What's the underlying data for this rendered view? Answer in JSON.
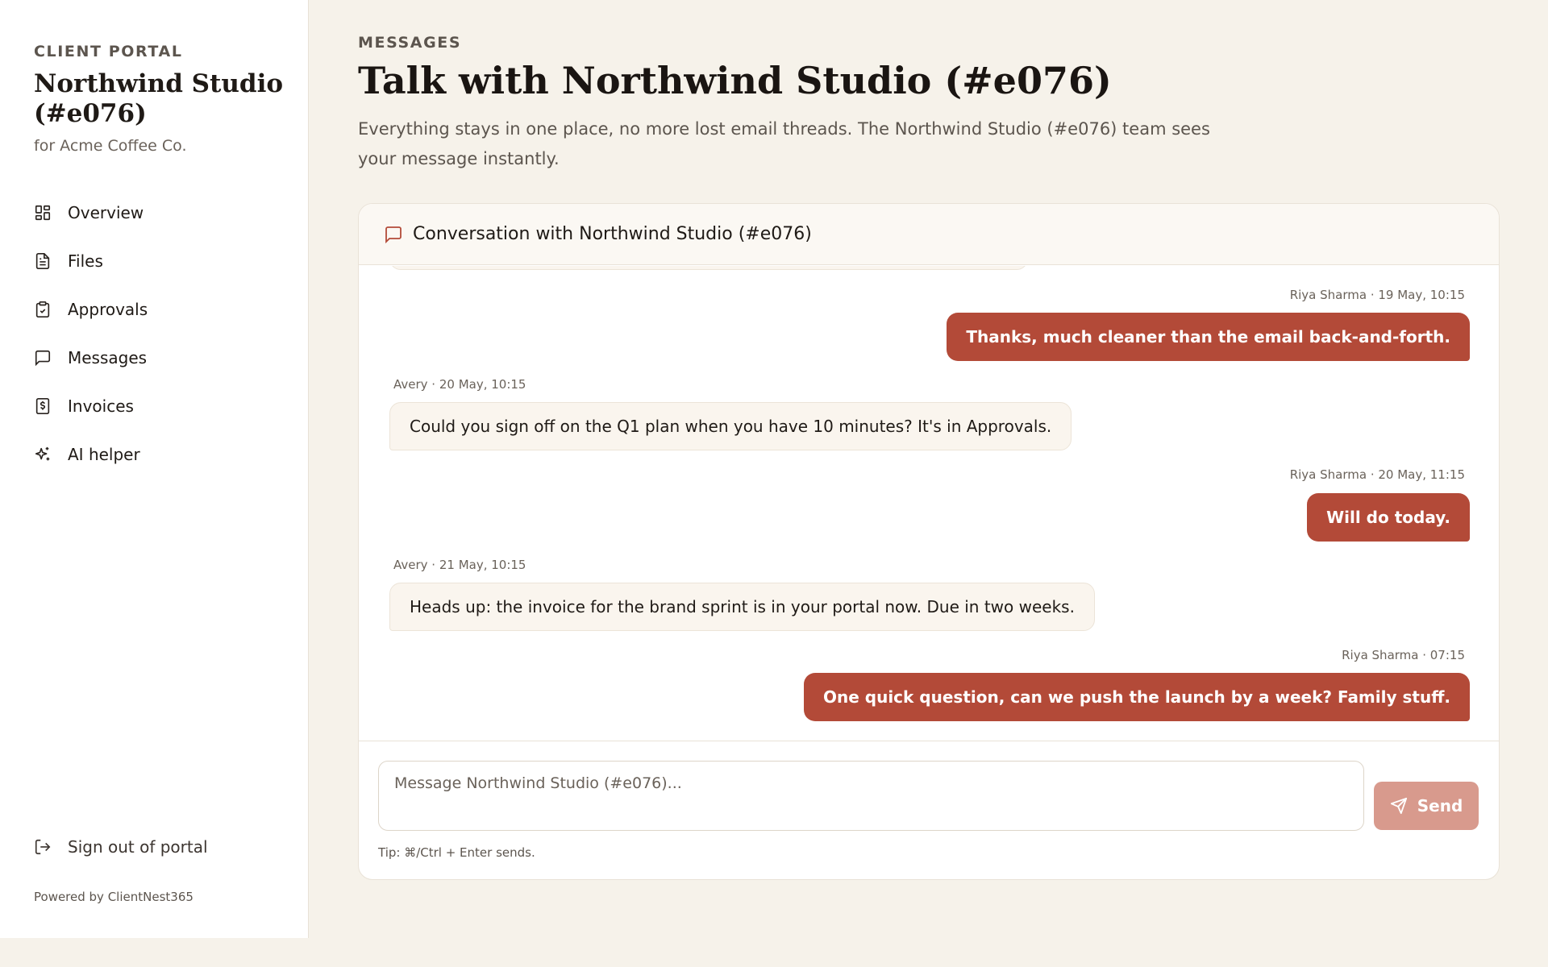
{
  "sidebar": {
    "eyebrow": "CLIENT PORTAL",
    "studio_name": "Northwind Studio (#e076)",
    "client_name": "for Acme Coffee Co.",
    "nav": [
      {
        "label": "Overview",
        "icon": "grid-icon"
      },
      {
        "label": "Files",
        "icon": "file-icon"
      },
      {
        "label": "Approvals",
        "icon": "clipboard-check-icon"
      },
      {
        "label": "Messages",
        "icon": "message-icon"
      },
      {
        "label": "Invoices",
        "icon": "invoice-dollar-icon"
      },
      {
        "label": "AI helper",
        "icon": "sparkles-icon"
      }
    ],
    "signout_label": "Sign out of portal",
    "powered_by": "Powered by ClientNest365"
  },
  "header": {
    "eyebrow": "MESSAGES",
    "title": "Talk with Northwind Studio (#e076)",
    "description": "Everything stays in one place, no more lost email threads. The Northwind Studio (#e076) team sees your message instantly."
  },
  "conversation": {
    "title": "Conversation with Northwind Studio (#e076)",
    "messages": [
      {
        "meta": "Riya Sharma · 19 May, 10:15",
        "text": "Thanks, much cleaner than the email back-and-forth.",
        "direction": "out"
      },
      {
        "meta": "Avery · 20 May, 10:15",
        "text": "Could you sign off on the Q1 plan when you have 10 minutes? It's in Approvals.",
        "direction": "in"
      },
      {
        "meta": "Riya Sharma · 20 May, 11:15",
        "text": "Will do today.",
        "direction": "out"
      },
      {
        "meta": "Avery · 21 May, 10:15",
        "text": "Heads up: the invoice for the brand sprint is in your portal now. Due in two weeks.",
        "direction": "in"
      },
      {
        "meta": "Riya Sharma · 07:15",
        "text": "One quick question, can we push the launch by a week? Family stuff.",
        "direction": "out"
      }
    ]
  },
  "composer": {
    "placeholder": "Message Northwind Studio (#e076)...",
    "value": "",
    "send_label": "Send",
    "tip": "Tip: ⌘/Ctrl + Enter sends."
  },
  "colors": {
    "accent": "#b34a38",
    "accent_disabled": "#d89a8d",
    "background": "#f6f2ea"
  }
}
